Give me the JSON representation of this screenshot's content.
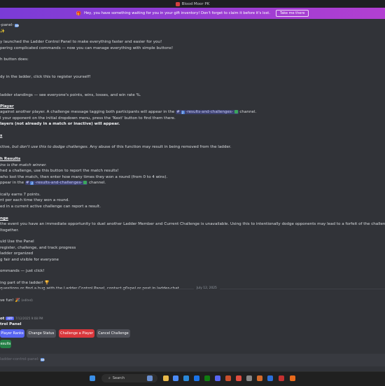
{
  "window": {
    "title": "Blood Moor PK"
  },
  "banner": {
    "icon": "gift-icon",
    "text": "Hey, you have something waiting for you in your gift inventory! Don't forget to claim it before it's lost.",
    "button": "Take me there"
  },
  "message": {
    "l1": "-panel-",
    "l2": "✨",
    "l3": "y launched the Ladder Control Panel to make everything faster and easier for you!",
    "l4": "pering complicated commands — now you can manage everything with simple buttons!",
    "l5": "h button does:",
    "l6": "dy in the ladder, click this to register yourself!",
    "l7": "ladder standings — see everyone's points, wins, losses, and win rate %.",
    "h_challenge": "Player",
    "c1a": "against another player. A challenge message tagging both participants will appear in the",
    "c1_channel": "-results-and-challenges-",
    "c1b": "channel.",
    "c2": "l your opponent on the initial dropdown menu, press the 'Next' button to find them there.",
    "c3": "layers (not already in a match or inactive) will appear.",
    "h_s": "s",
    "s1a": "ctive,",
    "s1b": "but don't use this to dodge challenges.",
    "s1c": "Any abuse of this function may result in being removed from the ladder.",
    "h_results": "h Results",
    "r1": "ins is the match winner.",
    "r2": "hed a challenge, use this button to report the match results!",
    "r3": "who lost the match, then enter how many times they won a round (from 0 to 4 wins).",
    "r4a": "ppear in the",
    "r4_channel": "-results-and-challenges-",
    "r4b": "channel.",
    "p1": "ically earns 7 points.",
    "p2": "nt per each time they won a round.",
    "p3": "ed in a current active challenge can report a result.",
    "h_nge": "nge",
    "n1": "the event you have an immediate opportunity to duel another Ladder Member and Current Challenge is unavailable. Using this to intentionally dodge opponents may lead to a forfeit of the challenge; repeated dod",
    "n2": "ltogether.",
    "w1": "uld Use the Panel",
    "w2": "register, challenge, and track progress",
    "w3": "ladder organized",
    "w4": "g fair and visible for everyone",
    "w5": "ommands — just click!",
    "e1": "ing part of the ladder! 🏆",
    "e2": "questions or find a bug with the Ladder Control Panel, contact g0spel or post in ladder-chat.",
    "e3": "ve fun! 🎉",
    "edited": "(edited)"
  },
  "date_divider": "July 12, 2025",
  "bot": {
    "name": "ot",
    "tag": "APP",
    "timestamp": "7/12/2025 9:08 PM",
    "panel_title": "trol Panel"
  },
  "buttons": {
    "ranks": {
      "label": "Player Ranks",
      "color": "#5865f2"
    },
    "status": {
      "label": "Change Status",
      "color": "#4e5058"
    },
    "challenge": {
      "label": "Challenge a Player",
      "color": "#da373c"
    },
    "cancel": {
      "label": "Cancel Challenge",
      "color": "#4e5058"
    },
    "results": {
      "label": "esults",
      "color": "#248046"
    }
  },
  "composer": {
    "text": "ladder-control-panel-"
  },
  "taskbar": {
    "search": "Search"
  }
}
